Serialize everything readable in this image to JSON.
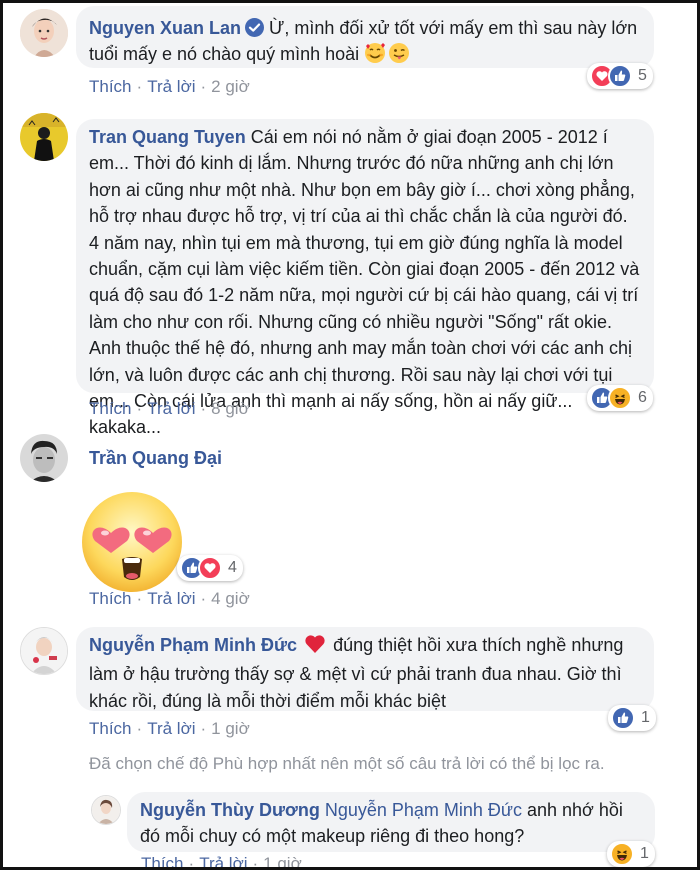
{
  "comments": [
    {
      "author": "Nguyen Xuan Lan",
      "verified": true,
      "text": "Ừ, mình đối xử tốt với mấy em thì sau này lớn tuổi mấy e nó chào quý mình hoài",
      "emoji": [
        "smiling-face-with-hearts",
        "tongue-wink"
      ],
      "like_label": "Thích",
      "reply_label": "Trả lời",
      "time": "2 giờ",
      "reaction_icons": [
        "love",
        "like"
      ],
      "reaction_count": "5"
    },
    {
      "author": "Tran Quang Tuyen",
      "text": "Cái em nói nó nằm ở giai đoạn 2005 - 2012 í em... Thời đó kinh dị lắm. Nhưng trước đó nữa những anh chị lớn hơn ai cũng như một nhà. Như bọn em bây giờ í... chơi xòng phẳng, hỗ trợ nhau được hỗ trợ, vị trí của ai thì chắc chắn là của người đó. 4 năm nay, nhìn tụi em mà thương, tụi em giờ đúng nghĩa là model chuẩn, cặm cụi làm việc kiếm tiền. Còn giai đoạn 2005 - đến 2012 và quá độ sau đó 1-2 năm nữa, mọi người cứ bị cái hào quang, cái vị trí làm cho như con rối. Nhưng cũng có nhiều người \"Sống\" rất okie. Anh thuộc thế hệ đó, nhưng anh may mắn toàn chơi với các anh chị lớn, và luôn được các anh chị thương. Rồi sau này lại chơi với tụi em... Còn cái lửa anh thì mạnh ai nấy sống, hồn ai nấy giữ... kakaka...",
      "like_label": "Thích",
      "reply_label": "Trả lời",
      "time": "8 giờ",
      "reaction_icons": [
        "like",
        "haha"
      ],
      "reaction_count": "6"
    },
    {
      "author": "Trần Quang Đại",
      "sticker": "heart-eyes-face",
      "like_label": "Thích",
      "reply_label": "Trả lời",
      "time": "4 giờ",
      "reaction_icons": [
        "like",
        "love"
      ],
      "reaction_count": "4"
    },
    {
      "author": "Nguyễn Phạm Minh Đức",
      "text": "đúng thiệt hồi xưa thích nghề nhưng làm ở hậu trường thấy sợ & mệt vì cứ phải tranh đua nhau. Giờ thì khác rồi, đúng là mỗi thời điểm mỗi khác biệt",
      "inline_emoji": "red-heart",
      "like_label": "Thích",
      "reply_label": "Trả lời",
      "time": "1 giờ",
      "reaction_icons": [
        "like"
      ],
      "reaction_count": "1"
    }
  ],
  "filter_note": "Đã chọn chế độ Phù hợp nhất nên một số câu trả lời có thể bị lọc ra.",
  "reply": {
    "author": "Nguyễn Thùy Dương",
    "mention": "Nguyễn Phạm Minh Đức",
    "text": "anh nhớ hồi đó mỗi chuy có một makeup riêng đi theo hong?",
    "like_label": "Thích",
    "reply_label": "Trả lời",
    "time": "1 giờ",
    "reaction_icons": [
      "haha"
    ],
    "reaction_count": "1"
  },
  "colors": {
    "name": "#385898",
    "bubble": "#f2f3f5",
    "like": "#4267b2",
    "love": "#f33e58",
    "haha": "#f7b125"
  }
}
